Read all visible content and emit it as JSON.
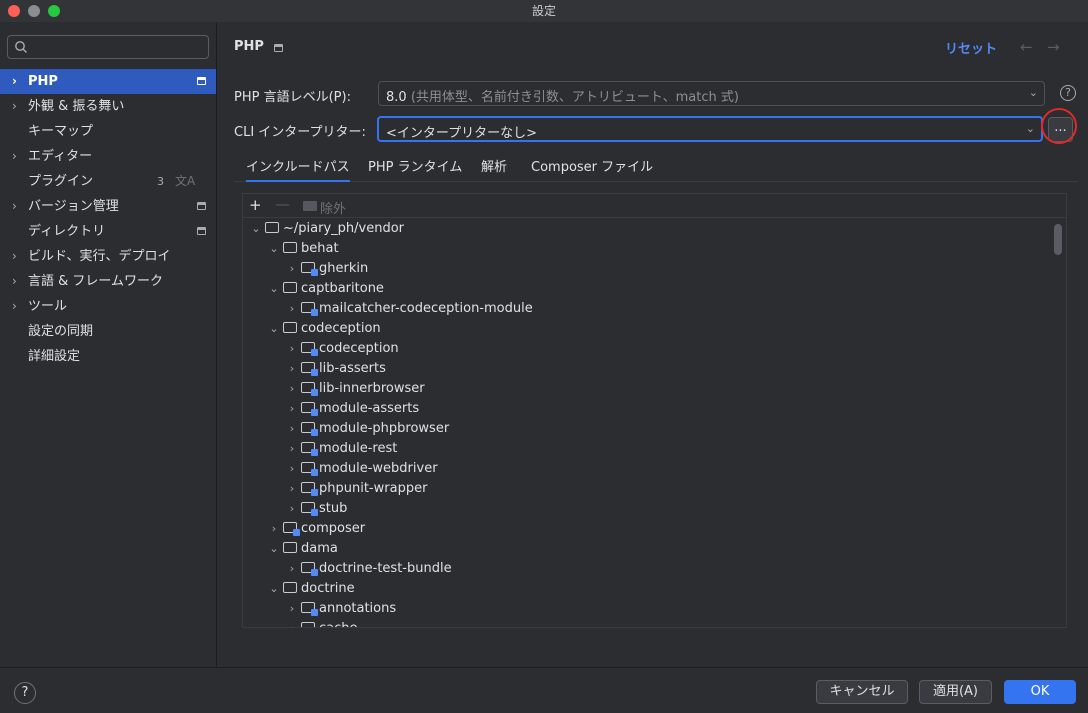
{
  "window": {
    "title": "設定"
  },
  "sidebar": {
    "items": [
      {
        "label": "PHP"
      },
      {
        "label": "外観 & 振る舞い"
      },
      {
        "label": "キーマップ"
      },
      {
        "label": "エディター"
      },
      {
        "label": "プラグイン",
        "count": "3"
      },
      {
        "label": "バージョン管理"
      },
      {
        "label": "ディレクトリ"
      },
      {
        "label": "ビルド、実行、デプロイ"
      },
      {
        "label": "言語 & フレームワーク"
      },
      {
        "label": "ツール"
      },
      {
        "label": "設定の同期"
      },
      {
        "label": "詳細設定"
      }
    ]
  },
  "header": {
    "title": "PHP",
    "reset_label": "リセット"
  },
  "form": {
    "language_level_label": "PHP 言語レベル(P):",
    "language_level_value": "8.0",
    "language_level_hint": "(共用体型、名前付き引数、アトリビュート、match 式)",
    "cli_label": "CLI インタープリター:",
    "cli_value": "<インタープリターなし>",
    "browse_label": "...",
    "help_label": "?"
  },
  "tabs": [
    {
      "label": "インクルードパス"
    },
    {
      "label": "PHP ランタイム"
    },
    {
      "label": "解析"
    },
    {
      "label": "Composer ファイル"
    }
  ],
  "tree_toolbar": {
    "exclude_label": "除外"
  },
  "tree": [
    {
      "label": "~/piary_ph/vendor"
    },
    {
      "label": "behat"
    },
    {
      "label": "gherkin"
    },
    {
      "label": "captbaritone"
    },
    {
      "label": "mailcatcher-codeception-module"
    },
    {
      "label": "codeception"
    },
    {
      "label": "codeception"
    },
    {
      "label": "lib-asserts"
    },
    {
      "label": "lib-innerbrowser"
    },
    {
      "label": "module-asserts"
    },
    {
      "label": "module-phpbrowser"
    },
    {
      "label": "module-rest"
    },
    {
      "label": "module-webdriver"
    },
    {
      "label": "phpunit-wrapper"
    },
    {
      "label": "stub"
    },
    {
      "label": "composer"
    },
    {
      "label": "dama"
    },
    {
      "label": "doctrine-test-bundle"
    },
    {
      "label": "doctrine"
    },
    {
      "label": "annotations"
    },
    {
      "label": "cache"
    }
  ],
  "footer": {
    "help_label": "?",
    "cancel_label": "キャンセル",
    "apply_label": "適用(A)",
    "ok_label": "OK"
  },
  "colors": {
    "accent": "#3574f0",
    "selection": "#2e5bbd",
    "link": "#548af7",
    "highlight_ring": "#e02a2a"
  }
}
